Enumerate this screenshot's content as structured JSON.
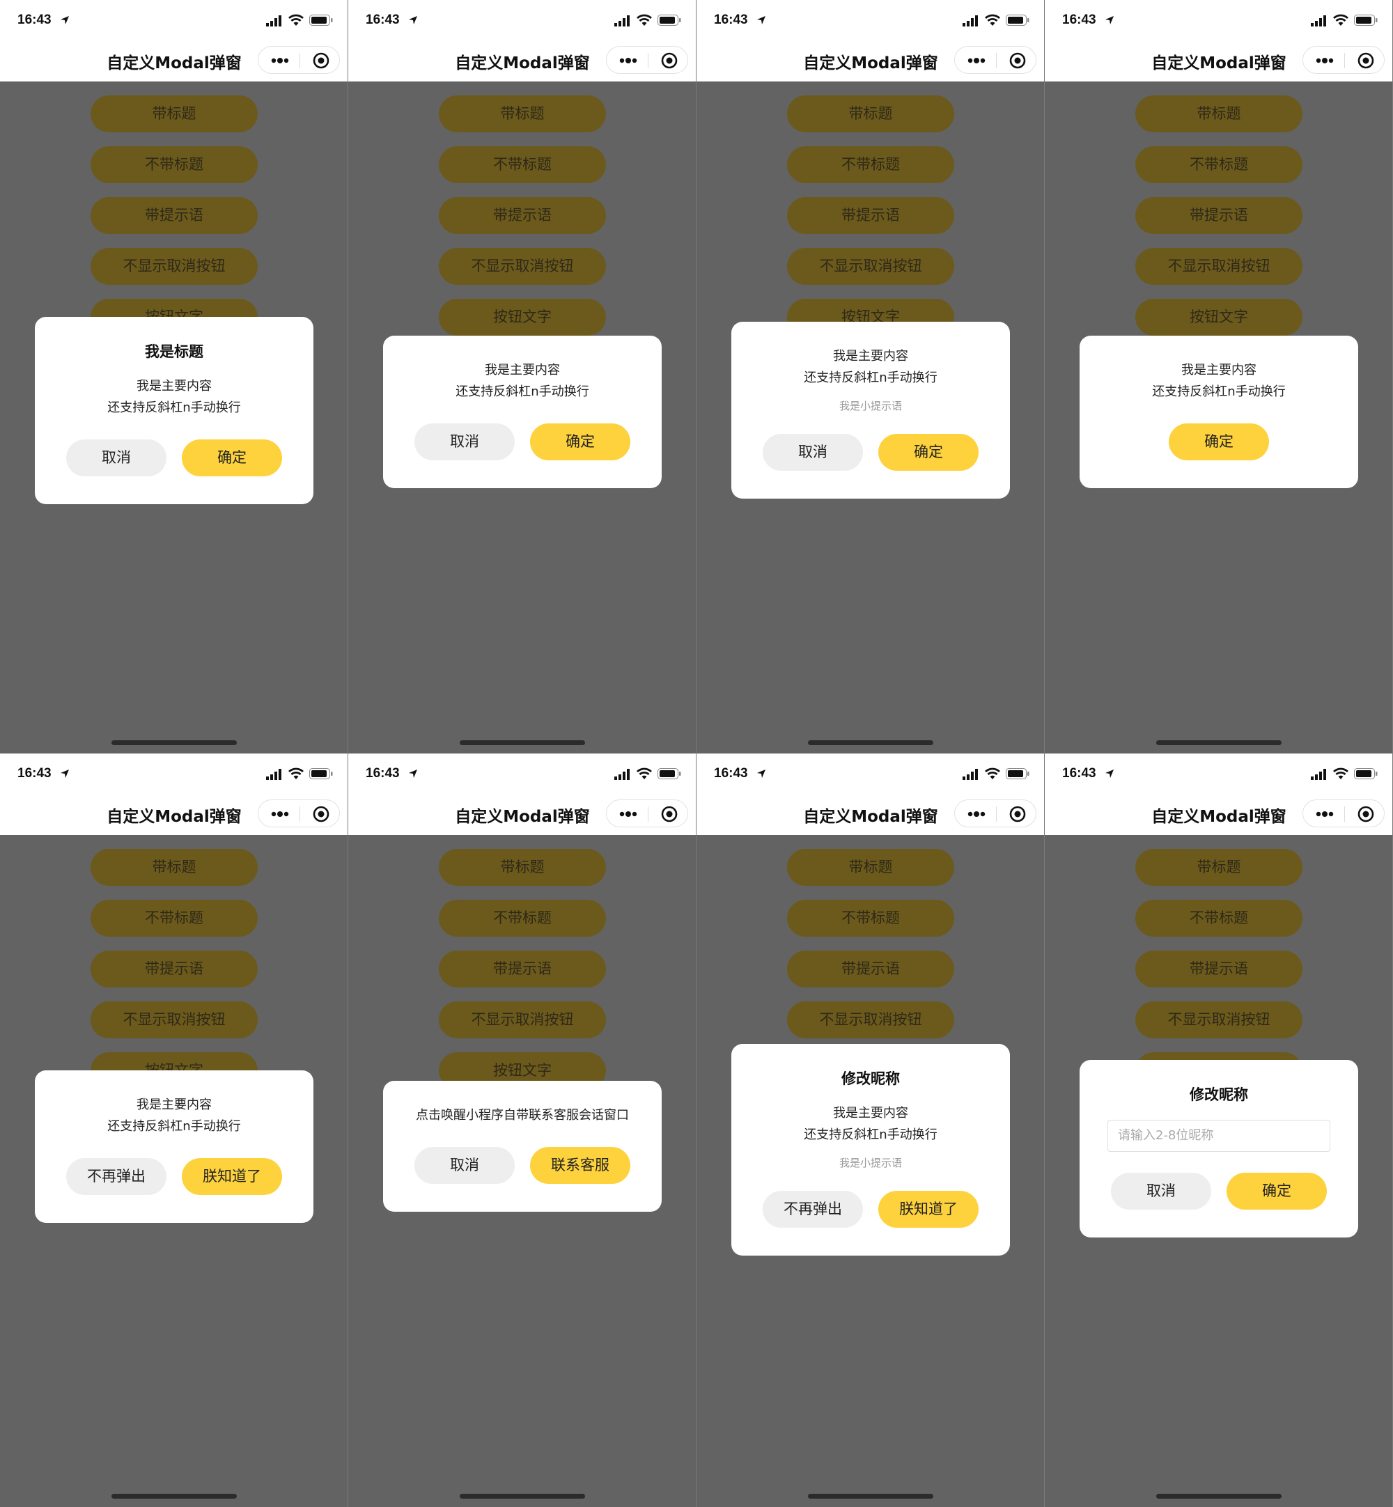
{
  "status": {
    "time": "16:43"
  },
  "nav": {
    "title": "自定义Modal弹窗"
  },
  "list_buttons": [
    "带标题",
    "不带标题",
    "带提示语",
    "不显示取消按钮",
    "按钮文字"
  ],
  "colors": {
    "confirm": "#fdd23d",
    "cancel": "#eeeeee",
    "mask": "#636363",
    "list_button": "#6b5a1c"
  },
  "screens": [
    {
      "modal": {
        "title": "我是标题",
        "body": [
          "我是主要内容",
          "还支持反斜杠n手动换行"
        ],
        "cancel": "取消",
        "confirm": "确定"
      }
    },
    {
      "modal": {
        "body": [
          "我是主要内容",
          "还支持反斜杠n手动换行"
        ],
        "cancel": "取消",
        "confirm": "确定"
      }
    },
    {
      "modal": {
        "body": [
          "我是主要内容",
          "还支持反斜杠n手动换行"
        ],
        "tip": "我是小提示语",
        "cancel": "取消",
        "confirm": "确定"
      }
    },
    {
      "modal": {
        "body": [
          "我是主要内容",
          "还支持反斜杠n手动换行"
        ],
        "confirm": "确定"
      }
    },
    {
      "modal": {
        "body": [
          "我是主要内容",
          "还支持反斜杠n手动换行"
        ],
        "cancel": "不再弹出",
        "confirm": "朕知道了"
      }
    },
    {
      "modal": {
        "body": [
          "点击唤醒小程序自带联系客服会话窗口"
        ],
        "cancel": "取消",
        "confirm": "联系客服"
      }
    },
    {
      "modal": {
        "title": "修改昵称",
        "body": [
          "我是主要内容",
          "还支持反斜杠n手动换行"
        ],
        "tip": "我是小提示语",
        "cancel": "不再弹出",
        "confirm": "朕知道了"
      }
    },
    {
      "modal": {
        "title": "修改昵称",
        "input_placeholder": "请输入2-8位昵称",
        "cancel": "取消",
        "confirm": "确定"
      }
    }
  ]
}
